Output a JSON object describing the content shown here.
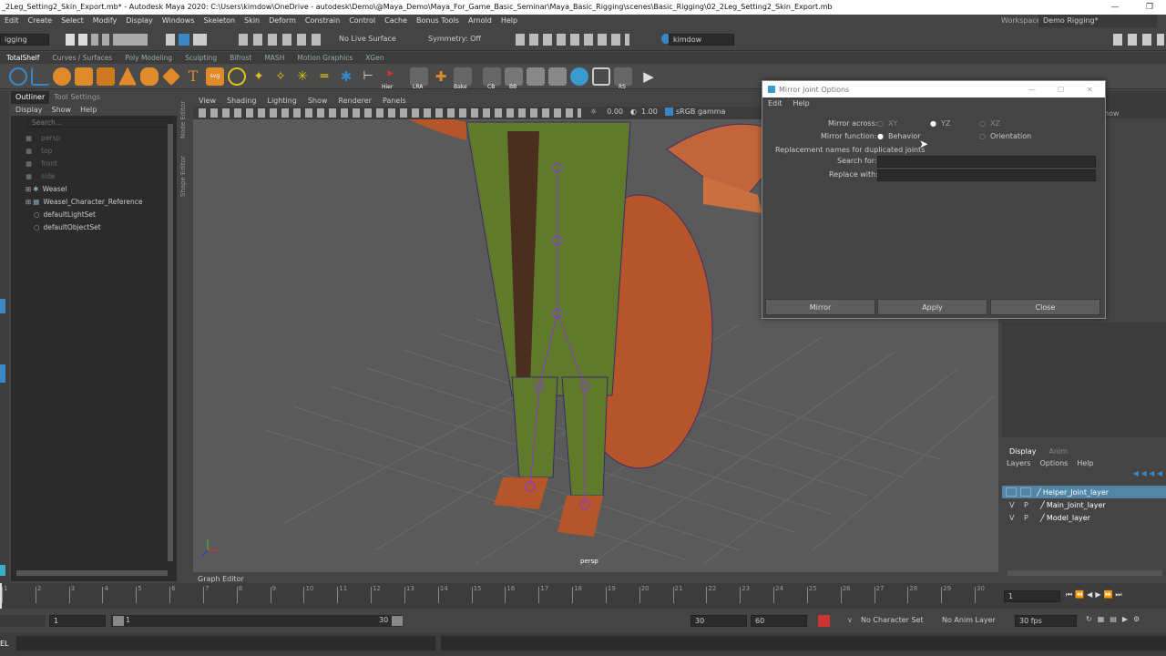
{
  "window": {
    "title": "_2Leg_Setting2_Skin_Export.mb* - Autodesk Maya 2020: C:\\Users\\kimdow\\OneDrive - autodesk\\Demo\\@Maya_Demo\\Maya_For_Game_Basic_Seminar\\Maya_Basic_Rigging\\scenes\\Basic_Rigging\\02_2Leg_Setting2_Skin_Export.mb"
  },
  "menubar": {
    "items": [
      "Edit",
      "Create",
      "Select",
      "Modify",
      "Display",
      "Windows",
      "Skeleton",
      "Skin",
      "Deform",
      "Constrain",
      "Control",
      "Cache",
      "Bonus Tools",
      "Arnold",
      "Help"
    ],
    "workspace_label": "Workspace :",
    "workspace_value": "Demo Rigging*"
  },
  "statusline": {
    "menuset": "igging",
    "live_surface": "No Live Surface",
    "symmetry": "Symmetry: Off",
    "user": "kimdow"
  },
  "shelf": {
    "tabs": [
      "TotalShelf",
      "Curves / Surfaces",
      "Poly Modeling",
      "Sculpting",
      "Bifrost",
      "MASH",
      "Motion Graphics",
      "XGen"
    ],
    "labels": {
      "hier": "Hier",
      "lra": "LRA",
      "bake": "Bake",
      "cb": "CB",
      "bb": "BB",
      "rs": "RS"
    }
  },
  "outliner": {
    "tabs": [
      "Outliner",
      "Tool Settings"
    ],
    "menu": [
      "Display",
      "Show",
      "Help"
    ],
    "search_placeholder": "Search...",
    "items": [
      "persp",
      "top",
      "front",
      "side",
      "Weasel",
      "Weasel_Character_Reference",
      "defaultLightSet",
      "defaultObjectSet"
    ]
  },
  "side_labels": {
    "node_editor": "Node Editor",
    "shape_editor": "Shape Editor"
  },
  "viewport": {
    "menu": [
      "View",
      "Shading",
      "Lighting",
      "Show",
      "Renderer",
      "Panels"
    ],
    "value1": "0.00",
    "value2": "1.00",
    "colorspace": "sRGB gamma",
    "camera": "persp"
  },
  "dialog": {
    "title": "Mirror Joint Options",
    "menu": [
      "Edit",
      "Help"
    ],
    "mirror_across_label": "Mirror across:",
    "mirror_across_options": [
      "XY",
      "YZ",
      "XZ"
    ],
    "mirror_across_selected": "YZ",
    "mirror_function_label": "Mirror function:",
    "mirror_function_options": [
      "Behavior",
      "Orientation"
    ],
    "mirror_function_selected": "Behavior",
    "replacement_label": "Replacement names for duplicated joints",
    "search_label": "Search for:",
    "search_value": "",
    "replace_label": "Replace with:",
    "replace_value": "",
    "buttons": [
      "Mirror",
      "Apply",
      "Close"
    ]
  },
  "graph_editor": "Graph Editor",
  "channelbox": {
    "show_label": "how"
  },
  "layers": {
    "tabs": [
      "Display",
      "Anim"
    ],
    "menu": [
      "Layers",
      "Options",
      "Help"
    ],
    "rows": [
      {
        "v": "",
        "p": "",
        "name": "Helper_Joint_layer"
      },
      {
        "v": "V",
        "p": "P",
        "name": "Main_Joint_layer"
      },
      {
        "v": "V",
        "p": "P",
        "name": "Model_layer"
      }
    ]
  },
  "timeline": {
    "ticks": [
      "1",
      "2",
      "3",
      "4",
      "5",
      "6",
      "7",
      "8",
      "9",
      "10",
      "11",
      "12",
      "13",
      "14",
      "15",
      "16",
      "17",
      "18",
      "19",
      "20",
      "21",
      "22",
      "23",
      "24",
      "25",
      "26",
      "27",
      "28",
      "29",
      "30"
    ],
    "current_frame": "1"
  },
  "range": {
    "start": "1",
    "inner_start": "1",
    "inner_end": "30",
    "end1": "30",
    "end2": "60",
    "character_set": "No Character Set",
    "anim_layer": "No Anim Layer",
    "fps": "30 fps"
  },
  "cmd": {
    "label": "EL"
  },
  "colors": {
    "accent": "#3a87c8",
    "highlight": "#5285a6",
    "layer_selected": "#5285a6"
  }
}
